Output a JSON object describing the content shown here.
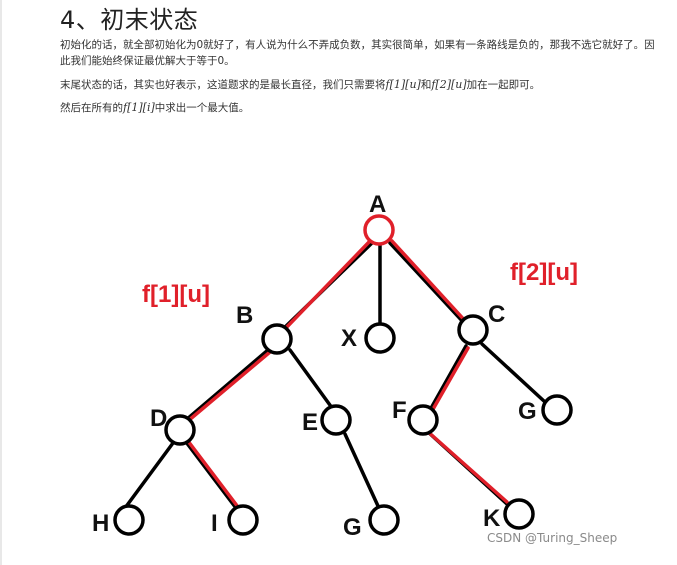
{
  "heading": "4、初末状态",
  "paragraphs": [
    "初始化的话，就全部初始化为0就好了，有人说为什么不弄成负数，其实很简单，如果有一条路线是负的，那我不选它就好了。因此我们能始终保证最优解大于等于0。",
    "末尾状态的话，其实也好表示，这道题求的是最长直径，我们只需要将",
    "f[1][u]",
    "和",
    "f[2][u]",
    "加在一起即可。",
    "然后在所有的",
    "f[1][i]",
    "中求出一个最大值。"
  ],
  "diagram": {
    "annotation_left": "f[1][u]",
    "annotation_right": "f[2][u]",
    "nodes": {
      "A": "A",
      "B": "B",
      "X": "X",
      "C": "C",
      "D": "D",
      "E": "E",
      "F": "F",
      "G1": "G",
      "H": "H",
      "I": "I",
      "G2": "G",
      "K": "K"
    },
    "colors": {
      "highlight": "#e0202a",
      "line": "#000000"
    }
  },
  "watermark": "CSDN @Turing_Sheep"
}
